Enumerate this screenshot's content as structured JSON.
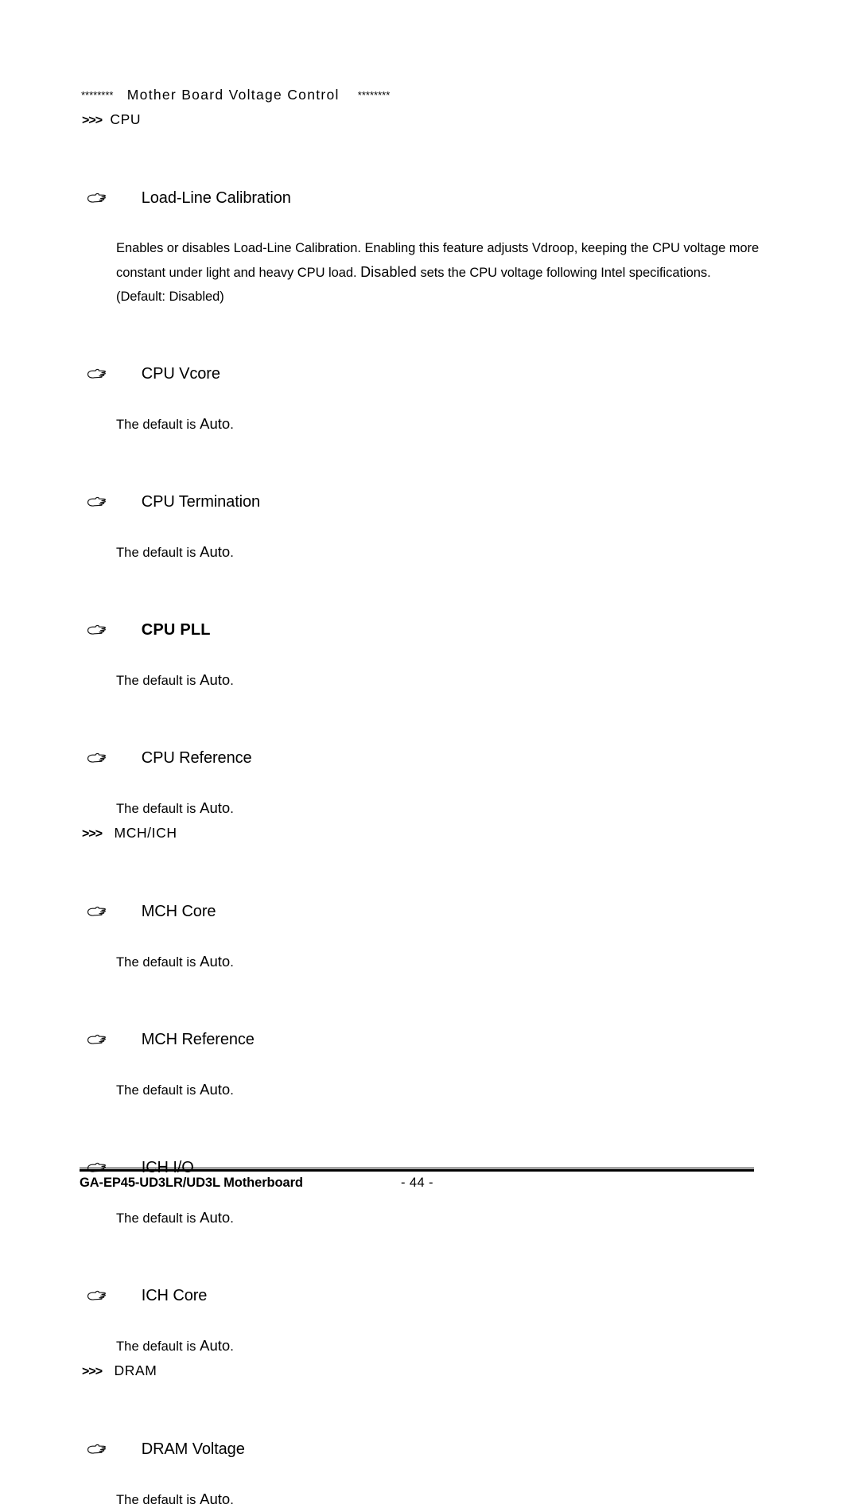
{
  "page": {
    "banner": {
      "stars_left": "********",
      "title": "Mother Board Voltage Control",
      "stars_right": "********"
    },
    "sections": [
      {
        "arrows": ">>>",
        "label": "CPU",
        "items": [
          {
            "icon": "pointing-hand-icon",
            "label": "Load-Line Calibration",
            "bold": false,
            "body_parts": [
              {
                "text": "Enables or disables Load-Line Calibration. Enabling this feature adjusts Vdroop, keeping the CPU voltage more constant under light and heavy CPU load. ",
                "emph": false
              },
              {
                "text": "Disabled",
                "emph": true
              },
              {
                "text": " sets the CPU voltage following Intel specifications. (Default: Disabled)",
                "emph": false
              }
            ]
          },
          {
            "icon": "pointing-hand-icon",
            "label": "CPU Vcore",
            "bold": false,
            "default_prefix": "The default is ",
            "default_value": "Auto",
            "default_suffix": "."
          },
          {
            "icon": "pointing-hand-icon",
            "label": "CPU Termination",
            "bold": false,
            "default_prefix": "The default is ",
            "default_value": "Auto",
            "default_suffix": "."
          },
          {
            "icon": "pointing-hand-icon",
            "label": "CPU PLL",
            "bold": true,
            "default_prefix": "The default is ",
            "default_value": "Auto",
            "default_suffix": "."
          },
          {
            "icon": "pointing-hand-icon",
            "label": "CPU Reference",
            "bold": false,
            "default_prefix": "The default is ",
            "default_value": "Auto",
            "default_suffix": "."
          }
        ]
      },
      {
        "arrows": ">>>",
        "label": "MCH/ICH",
        "items": [
          {
            "icon": "pointing-hand-icon",
            "label": "MCH Core",
            "bold": false,
            "default_prefix": "The default is ",
            "default_value": "Auto",
            "default_suffix": "."
          },
          {
            "icon": "pointing-hand-icon",
            "label": "MCH Reference",
            "bold": false,
            "default_prefix": "The default is ",
            "default_value": "Auto",
            "default_suffix": "."
          },
          {
            "icon": "pointing-hand-icon",
            "label": "ICH I/O",
            "bold": false,
            "default_prefix": "The default is ",
            "default_value": "Auto",
            "default_suffix": "."
          },
          {
            "icon": "pointing-hand-icon",
            "label": "ICH Core",
            "bold": false,
            "default_prefix": "The default is ",
            "default_value": "Auto",
            "default_suffix": "."
          }
        ]
      },
      {
        "arrows": ">>>",
        "label": "DRAM",
        "items": [
          {
            "icon": "pointing-hand-icon",
            "label": "DRAM Voltage",
            "bold": false,
            "default_prefix": "The default is ",
            "default_value": "Auto",
            "default_suffix": "."
          }
        ]
      }
    ],
    "footer": {
      "product": "GA-EP45-UD3LR/UD3L Motherboard",
      "page_number": "- 44 -"
    }
  }
}
